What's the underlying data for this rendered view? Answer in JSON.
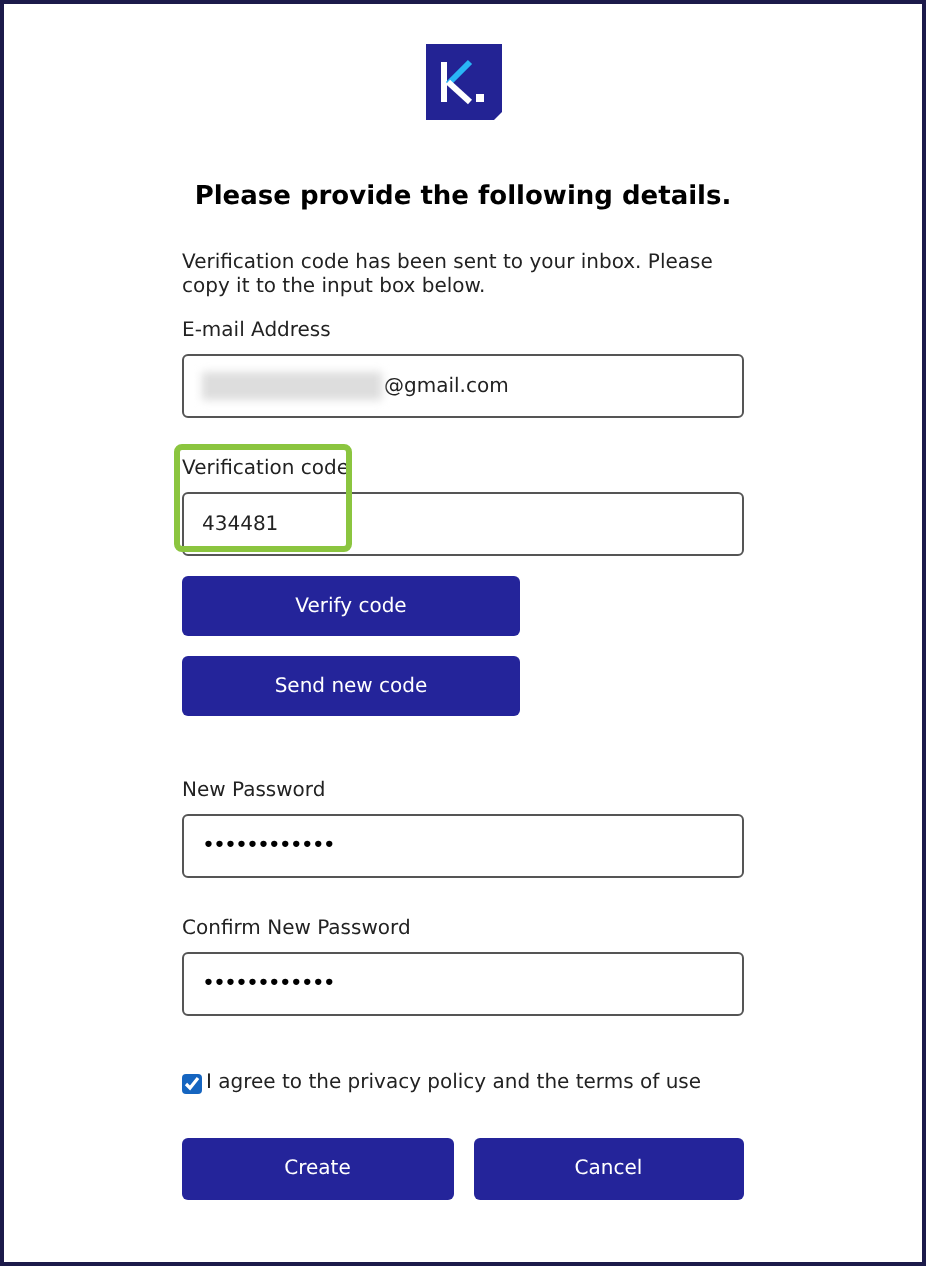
{
  "heading": "Please provide the following details.",
  "instructions": "Verification code has been sent to your inbox. Please copy it to the input box below.",
  "fields": [
    {
      "label": "E-mail Address",
      "value": "@gmail.com",
      "redacted": true,
      "highlighted": false
    },
    {
      "label": "Verification code",
      "value": "434481",
      "redacted": false,
      "highlighted": true
    }
  ],
  "code_buttons": [
    "Verify code",
    "Send new code"
  ],
  "password_fields": [
    {
      "label": "New Password",
      "value": "••••••••••••"
    },
    {
      "label": "Confirm New Password",
      "value": "••••••••••••"
    }
  ],
  "agreement": {
    "label": "I agree to the privacy policy and the terms of use",
    "checked": true
  },
  "buttons": [
    "Create",
    "Cancel"
  ]
}
